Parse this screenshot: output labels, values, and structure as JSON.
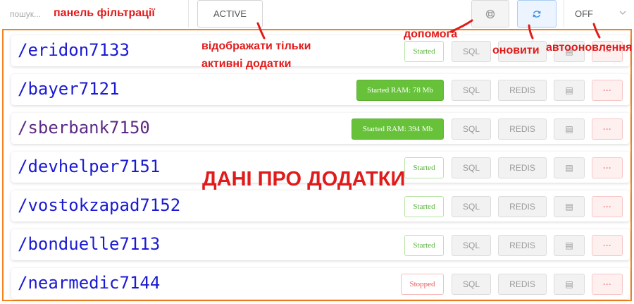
{
  "search": {
    "placeholder": "пошук..."
  },
  "toolbar": {
    "active_label": "ACTIVE",
    "help_icon": "lifebuoy-icon",
    "refresh_icon": "refresh-icon",
    "autorefresh_value": "OFF"
  },
  "apps": [
    {
      "name": "/eridon7133",
      "status": "Started",
      "status_type": "started",
      "sql": "SQL",
      "redis": ""
    },
    {
      "name": "/bayer7121",
      "status": "Started RAM: 78 Mb",
      "status_type": "ram",
      "sql": "SQL",
      "redis": "REDIS"
    },
    {
      "name": "/sberbank7150",
      "status": "Started RAM: 394 Mb",
      "status_type": "ram",
      "sql": "SQL",
      "redis": "REDIS"
    },
    {
      "name": "/devhelper7151",
      "status": "Started",
      "status_type": "started",
      "sql": "SQL",
      "redis": "REDIS"
    },
    {
      "name": "/vostokzapad7152",
      "status": "Started",
      "status_type": "started",
      "sql": "SQL",
      "redis": "REDIS"
    },
    {
      "name": "/bonduelle7113",
      "status": "Started",
      "status_type": "started",
      "sql": "SQL",
      "redis": "REDIS"
    },
    {
      "name": "/nearmedic7144",
      "status": "Stopped",
      "status_type": "stopped",
      "sql": "SQL",
      "redis": "REDIS"
    }
  ],
  "annotations": {
    "filter_panel": "панель фільтрації",
    "active_only_line1": "відображати тільки",
    "active_only_line2": "активні додатки",
    "help": "допомога",
    "refresh": "оновити",
    "autorefresh": "автооновлення",
    "apps_data": "ДАНІ ПРО ДОДАТКИ"
  },
  "colors": {
    "annotation": "#e01b1b",
    "panel_border": "#f5821f",
    "link": "#1a1ad4",
    "visited_link": "#5d2a85",
    "ram_badge": "#67c23a",
    "started_text": "#58b33a",
    "stopped_text": "#e35b5b"
  }
}
